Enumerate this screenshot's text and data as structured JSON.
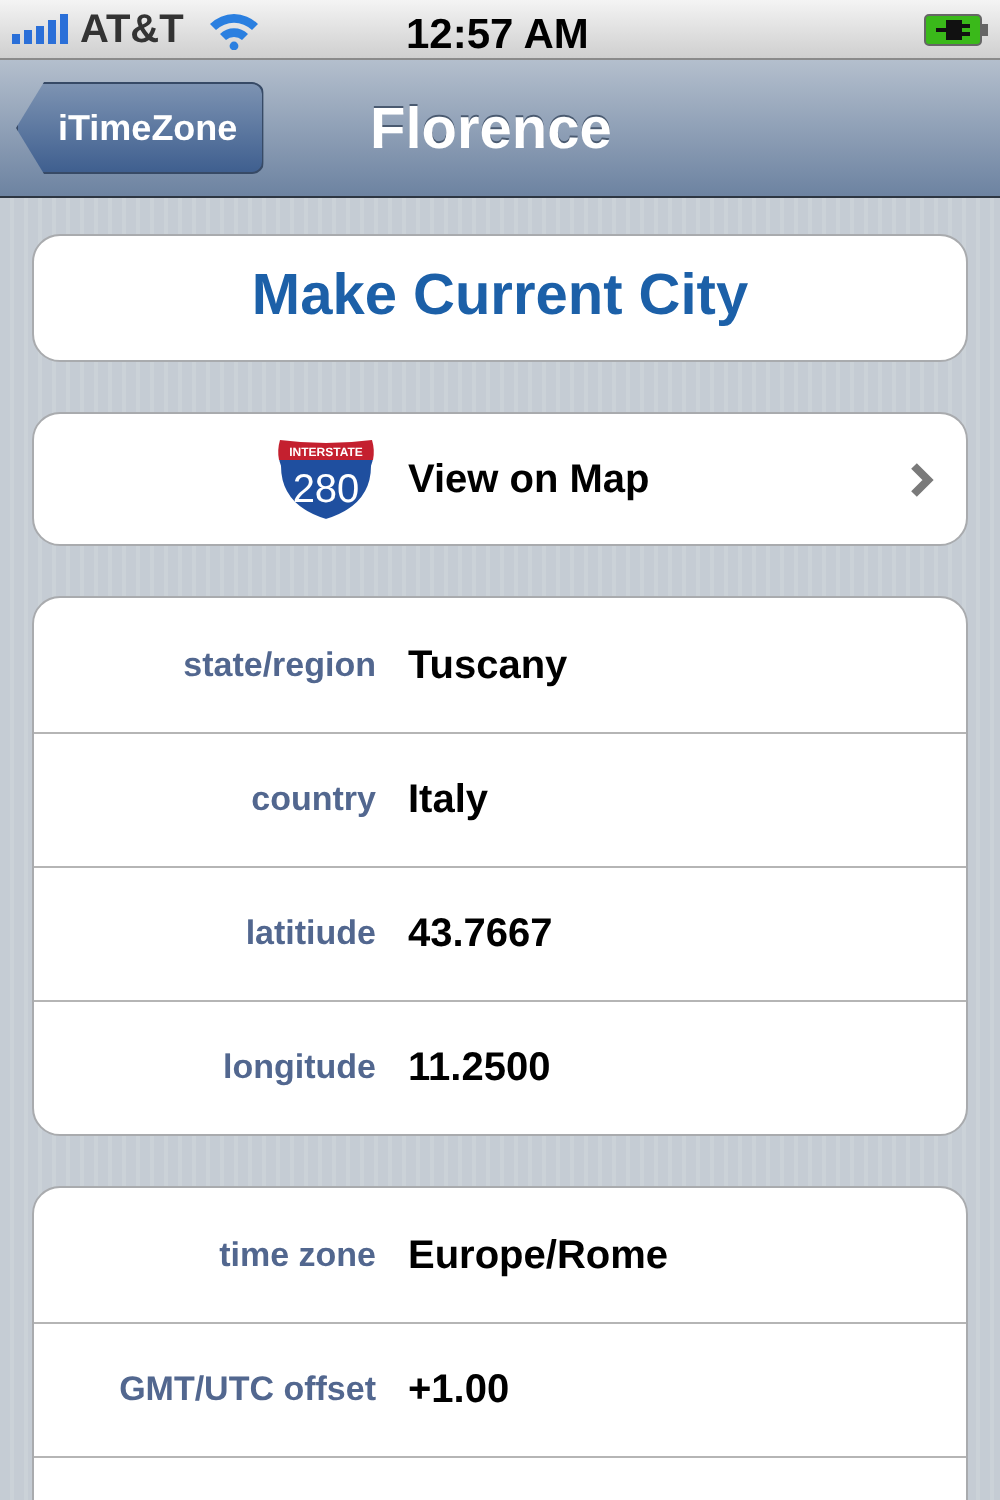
{
  "status_bar": {
    "carrier": "AT&T",
    "time": "12:57 AM"
  },
  "nav_bar": {
    "back_button": "iTimeZone",
    "title": "Florence"
  },
  "make_current_button": "Make Current City",
  "map_row": {
    "sign_top": "INTERSTATE",
    "sign_number": "280",
    "label": "View on Map"
  },
  "location_details": [
    {
      "label": "state/region",
      "value": "Tuscany"
    },
    {
      "label": "country",
      "value": "Italy"
    },
    {
      "label": "latitiude",
      "value": "43.7667"
    },
    {
      "label": "longitude",
      "value": "11.2500"
    }
  ],
  "time_details": [
    {
      "label": "time zone",
      "value": "Europe/Rome"
    },
    {
      "label": "GMT/UTC offset",
      "value": "+1.00"
    }
  ]
}
